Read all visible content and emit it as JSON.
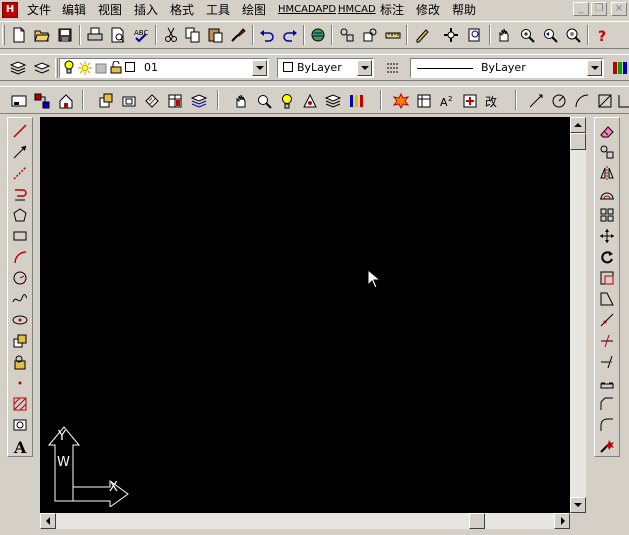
{
  "app": {
    "icon_letter": "H"
  },
  "menubar": {
    "items": [
      {
        "label": "文件",
        "name": "menu-file"
      },
      {
        "label": "编辑",
        "name": "menu-edit"
      },
      {
        "label": "视图",
        "name": "menu-view"
      },
      {
        "label": "插入",
        "name": "menu-insert"
      },
      {
        "label": "格式",
        "name": "menu-format"
      },
      {
        "label": "工具",
        "name": "menu-tools"
      },
      {
        "label": "绘图",
        "name": "menu-draw"
      },
      {
        "label": "HMCADAPD",
        "name": "menu-hmcadapd"
      },
      {
        "label": "HMCAD",
        "name": "menu-hmcad"
      },
      {
        "label": "标注",
        "name": "menu-dimension"
      },
      {
        "label": "修改",
        "name": "menu-modify"
      },
      {
        "label": "帮助",
        "name": "menu-help"
      }
    ],
    "window_buttons": {
      "minimize": "_",
      "restore": "❐",
      "close": "×"
    }
  },
  "layer_toolbar": {
    "layer_value": "01",
    "color_value": "ByLayer",
    "linetype_value": "ByLayer"
  },
  "ucs": {
    "x_label": "X",
    "y_label": "Y",
    "w_label": "W"
  },
  "colors": {
    "canvas": "#000000",
    "chrome": "#d4d0c8",
    "icon_red": "#c00000",
    "icon_blue": "#0000a0"
  }
}
